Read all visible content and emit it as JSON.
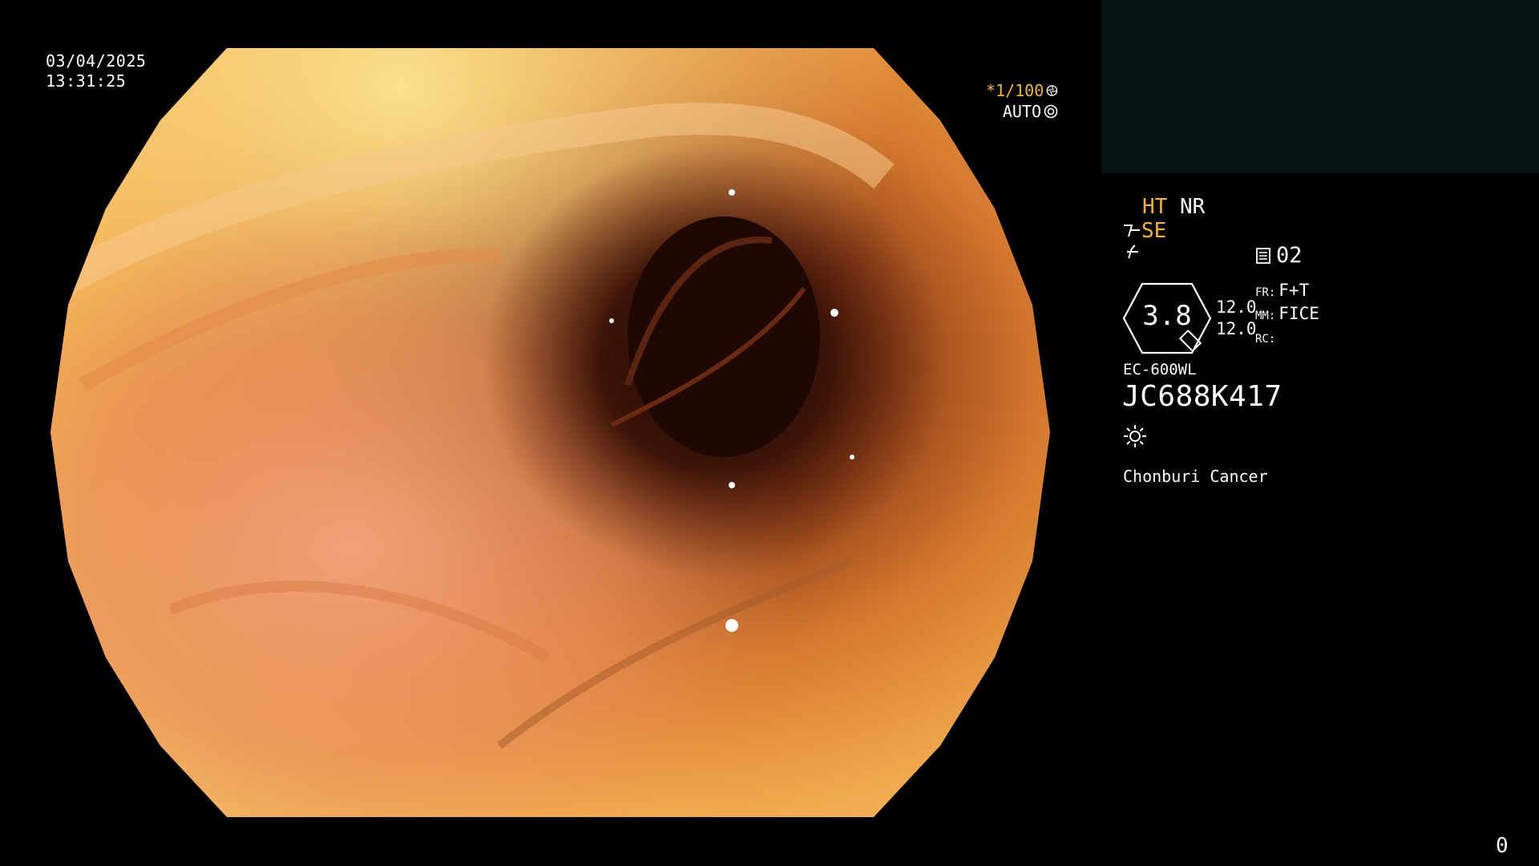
{
  "overlay": {
    "date": "03/04/2025",
    "time": "13:31:25",
    "shutter": "*1/100",
    "exposure_mode": "AUTO",
    "page_number": "0"
  },
  "panel": {
    "ht": "HT",
    "nr": "NR",
    "se": "SE",
    "count": "02",
    "magnification": "3.8",
    "value_1": "12.0",
    "value_2": "12.0",
    "fr_label": "FR:",
    "fr_value": "F+T",
    "mm_label": "MM:",
    "mm_value": "FICE",
    "rc_label": "RC:",
    "scope_model": "EC-600WL",
    "scope_serial": "JC688K417",
    "institution": "Chonburi Cancer"
  },
  "icons": {
    "shutter": "aperture-icon",
    "auto": "exposure-icon",
    "se": "scope-se-icon",
    "f": "enhancement-icon",
    "count": "memory-card-icon",
    "light": "light-source-icon"
  },
  "colors": {
    "accent": "#f5b52a",
    "text": "#ffffff",
    "background": "#000000",
    "thumbnail_panel": "#031413"
  }
}
